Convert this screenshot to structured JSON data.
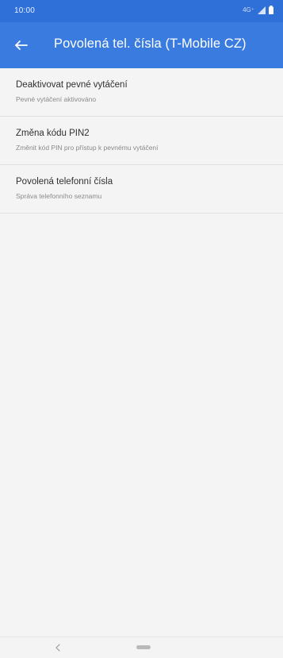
{
  "status_bar": {
    "time": "10:00",
    "network": "4G⁺"
  },
  "app_bar": {
    "title": "Povolená tel. čísla (T-Mobile CZ)",
    "back_icon": "arrow-left-icon"
  },
  "list": {
    "items": [
      {
        "title": "Deaktivovat pevné vytáčení",
        "subtitle": "Pevné vytáčení aktivováno"
      },
      {
        "title": "Změna kódu PIN2",
        "subtitle": "Změnit kód PIN pro přístup k pevnému vytáčení"
      },
      {
        "title": "Povolená telefonní čísla",
        "subtitle": "Správa telefonního seznamu"
      }
    ]
  },
  "nav_bar": {
    "back_icon": "chevron-left-icon",
    "home_icon": "home-pill-icon"
  },
  "colors": {
    "status_bar": "#2f6fd8",
    "app_bar": "#3a7be0",
    "background": "#f4f4f4"
  }
}
